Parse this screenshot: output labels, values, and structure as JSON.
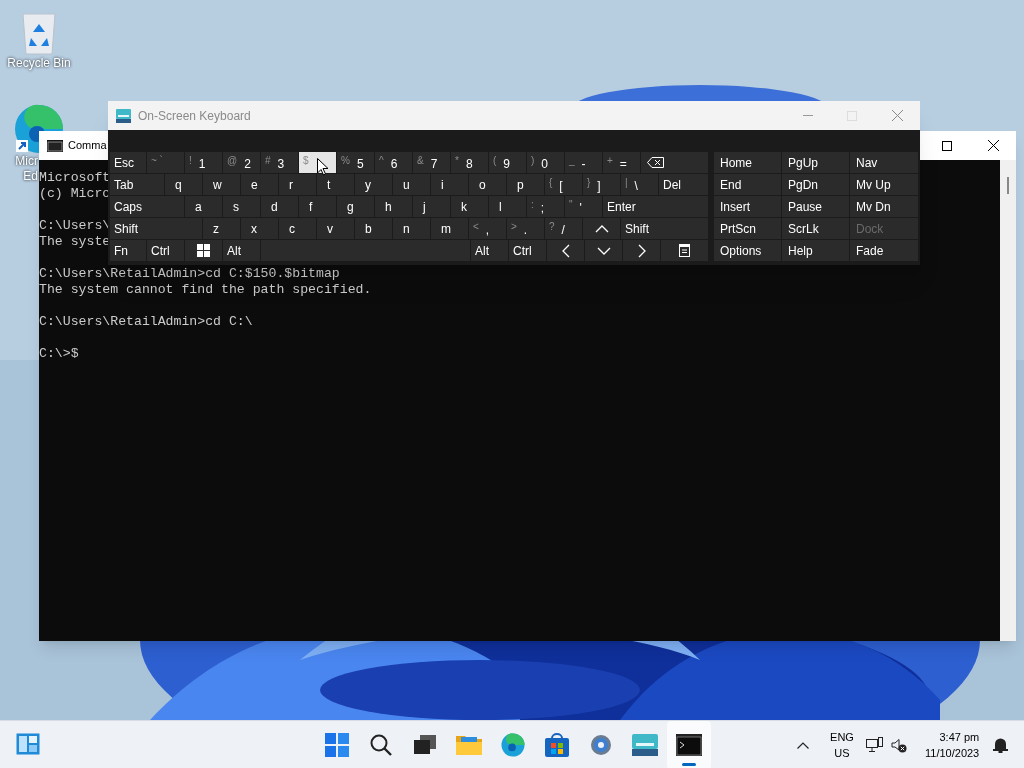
{
  "desktop_icons": [
    {
      "kind": "recycle",
      "label_lines": [
        "Recycle Bin"
      ]
    },
    {
      "kind": "edge",
      "label_lines": [
        "Micr",
        "Ed"
      ]
    }
  ],
  "cmd_window": {
    "title": "Comma",
    "blocks": [
      [
        "Microsoft",
        "(c) Micro"
      ],
      [
        "C:\\Users\\",
        "The syste"
      ],
      [
        "C:\\Users\\RetailAdmin>cd C:$150.$bitmap",
        "The system cannot find the path specified."
      ],
      [
        "C:\\Users\\RetailAdmin>cd C:\\"
      ],
      [
        "C:\\>$"
      ]
    ]
  },
  "osk": {
    "title": "On-Screen Keyboard",
    "rows": [
      {
        "keys": [
          {
            "label": "Esc"
          },
          {
            "shift": "~ `"
          },
          {
            "shift": "!",
            "label": "1"
          },
          {
            "shift": "@",
            "label": "2"
          },
          {
            "shift": "#",
            "label": "3"
          },
          {
            "shift": "$",
            "hovered": true
          },
          {
            "shift": "%",
            "label": "5"
          },
          {
            "shift": "^",
            "label": "6"
          },
          {
            "shift": "&",
            "label": "7"
          },
          {
            "shift": "*",
            "label": "8"
          },
          {
            "shift": "(",
            "label": "9"
          },
          {
            "shift": ")",
            "label": "0"
          },
          {
            "shift": "_",
            "label": "-"
          },
          {
            "shift": "+",
            "label": "="
          },
          {
            "kind": "backspace"
          }
        ]
      },
      {
        "keys": [
          {
            "label": "Tab"
          },
          {
            "label": "q"
          },
          {
            "label": "w"
          },
          {
            "label": "e"
          },
          {
            "label": "r"
          },
          {
            "label": "t"
          },
          {
            "label": "y"
          },
          {
            "label": "u"
          },
          {
            "label": "i"
          },
          {
            "label": "o"
          },
          {
            "label": "p"
          },
          {
            "shift": "{",
            "label": "["
          },
          {
            "shift": "}",
            "label": "]"
          },
          {
            "shift": "|",
            "label": "\\"
          },
          {
            "label": "Del"
          }
        ]
      },
      {
        "keys": [
          {
            "label": "Caps"
          },
          {
            "label": "a"
          },
          {
            "label": "s"
          },
          {
            "label": "d"
          },
          {
            "label": "f"
          },
          {
            "label": "g"
          },
          {
            "label": "h"
          },
          {
            "label": "j"
          },
          {
            "label": "k"
          },
          {
            "label": "l"
          },
          {
            "shift": ":",
            "label": ";"
          },
          {
            "shift": "\"",
            "label": "'"
          },
          {
            "label": "Enter"
          }
        ]
      },
      {
        "keys": [
          {
            "label": "Shift"
          },
          {
            "label": "z"
          },
          {
            "label": "x"
          },
          {
            "label": "c"
          },
          {
            "label": "v"
          },
          {
            "label": "b"
          },
          {
            "label": "n"
          },
          {
            "label": "m"
          },
          {
            "shift": "<",
            "label": ","
          },
          {
            "shift": ">",
            "label": "."
          },
          {
            "shift": "?",
            "label": "/"
          },
          {
            "kind": "up"
          },
          {
            "label": "Shift"
          }
        ]
      },
      {
        "keys": [
          {
            "label": "Fn"
          },
          {
            "label": "Ctrl"
          },
          {
            "kind": "windows"
          },
          {
            "label": "Alt"
          },
          {
            "kind": "space"
          },
          {
            "label": "Alt"
          },
          {
            "label": "Ctrl"
          },
          {
            "kind": "left"
          },
          {
            "kind": "down"
          },
          {
            "kind": "right"
          },
          {
            "kind": "menu"
          }
        ]
      }
    ],
    "nav_keys": [
      {
        "label": "Home",
        "disabled": false
      },
      {
        "label": "PgUp",
        "disabled": false
      },
      {
        "label": "Nav",
        "disabled": false
      },
      {
        "label": "End",
        "disabled": false
      },
      {
        "label": "PgDn",
        "disabled": false
      },
      {
        "label": "Mv Up",
        "disabled": false
      },
      {
        "label": "Insert",
        "disabled": false
      },
      {
        "label": "Pause",
        "disabled": false
      },
      {
        "label": "Mv Dn",
        "disabled": false
      },
      {
        "label": "PrtScn",
        "disabled": false
      },
      {
        "label": "ScrLk",
        "disabled": false
      },
      {
        "label": "Dock",
        "disabled": true
      },
      {
        "label": "Options",
        "disabled": false
      },
      {
        "label": "Help",
        "disabled": false
      },
      {
        "label": "Fade",
        "disabled": false
      }
    ]
  },
  "taskbar": {
    "apps": [
      {
        "kind": "start",
        "active": false
      },
      {
        "kind": "search",
        "active": false
      },
      {
        "kind": "taskview",
        "active": false
      },
      {
        "kind": "explorer",
        "active": false
      },
      {
        "kind": "edge",
        "active": false
      },
      {
        "kind": "store",
        "active": false
      },
      {
        "kind": "settings",
        "active": false
      },
      {
        "kind": "osk",
        "active": false
      },
      {
        "kind": "cmd",
        "active": true
      }
    ],
    "language": [
      "ENG",
      "US"
    ],
    "time": "3:47 pm",
    "date": "11/10/2023"
  }
}
